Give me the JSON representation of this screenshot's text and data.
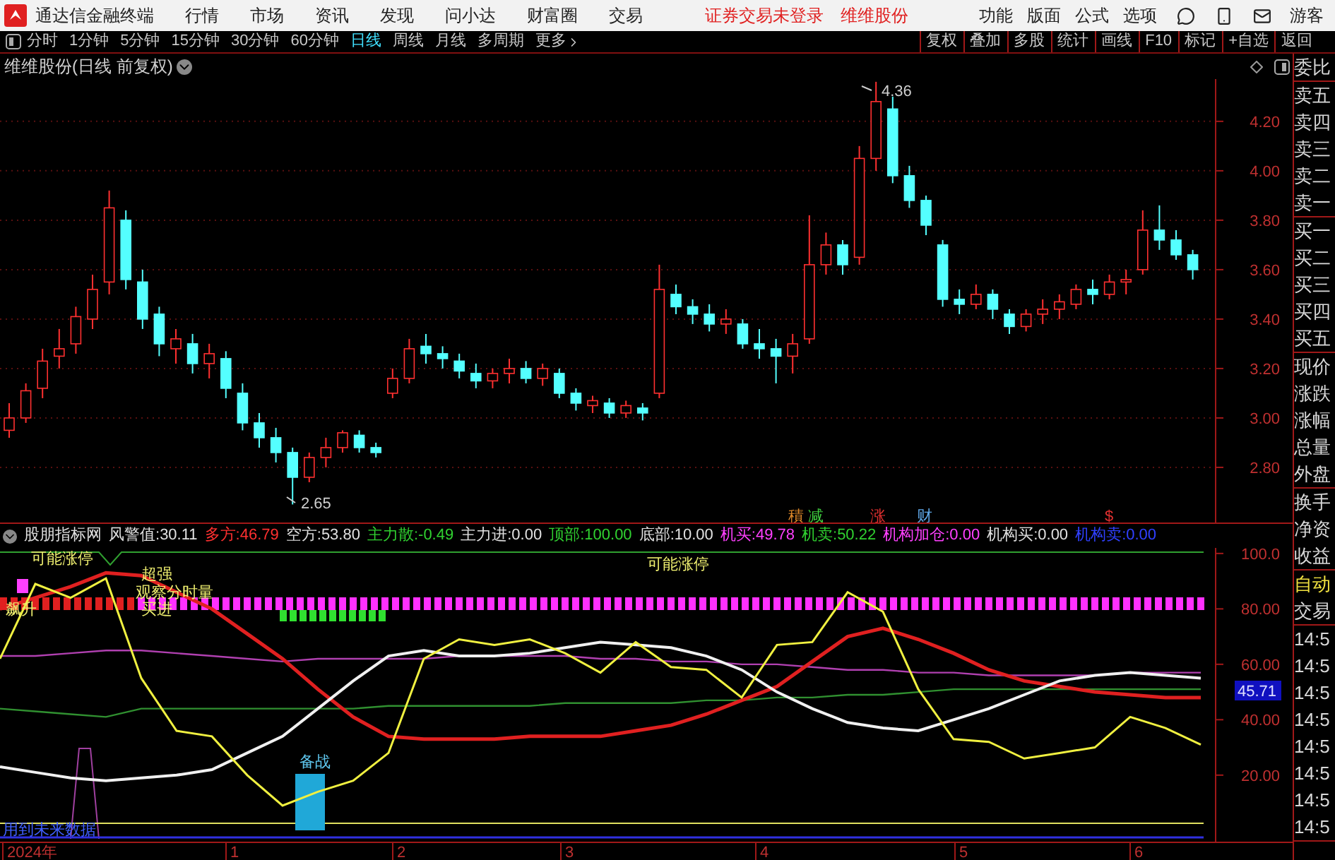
{
  "app_bar": {
    "title": "通达信金融终端",
    "menu": [
      "行情",
      "市场",
      "资讯",
      "发现",
      "问小达",
      "财富圈",
      "交易"
    ],
    "status": [
      "证券交易未登录",
      "维维股份"
    ],
    "right_menu": [
      "功能",
      "版面",
      "公式",
      "选项"
    ],
    "user": "游客"
  },
  "period_bar": {
    "tabs": [
      {
        "label": "分时",
        "selected": false
      },
      {
        "label": "1分钟",
        "selected": false
      },
      {
        "label": "5分钟",
        "selected": false
      },
      {
        "label": "15分钟",
        "selected": false
      },
      {
        "label": "30分钟",
        "selected": false
      },
      {
        "label": "60分钟",
        "selected": false
      },
      {
        "label": "日线",
        "selected": true
      },
      {
        "label": "周线",
        "selected": false
      },
      {
        "label": "月线",
        "selected": false
      },
      {
        "label": "多周期",
        "selected": false
      }
    ],
    "more": "更多",
    "buttons": [
      "复权",
      "叠加",
      "多股",
      "统计",
      "画线",
      "F10",
      "标记",
      "+自选",
      "返回"
    ]
  },
  "chart_title": "维维股份(日线 前复权)",
  "price_chart": {
    "high_label": "4.36",
    "low_label": "2.65",
    "event_marks": [
      {
        "text": "積",
        "color": "#e08a2a"
      },
      {
        "text": "减",
        "color": "#3fcf3f"
      },
      {
        "text": "涨",
        "color": "#e03030"
      },
      {
        "text": "财",
        "color": "#5fa8e8"
      },
      {
        "text": "$",
        "color": "#e03030"
      }
    ],
    "chart_data": {
      "type": "candlestick",
      "grid": true,
      "ylim": [
        2.577,
        4.371
      ],
      "yticks": [
        {
          "value": 4.2,
          "label": "4.20"
        },
        {
          "value": 4.0,
          "label": "4.00"
        },
        {
          "value": 3.8,
          "label": "3.80"
        },
        {
          "value": 3.6,
          "label": "3.60"
        },
        {
          "value": 3.4,
          "label": "3.40"
        },
        {
          "value": 3.2,
          "label": "3.20"
        },
        {
          "value": 3.0,
          "label": "3.00"
        },
        {
          "value": 2.8,
          "label": "2.80"
        }
      ],
      "ohlc": [
        [
          2.95,
          3.06,
          2.92,
          3.0
        ],
        [
          3.0,
          3.14,
          2.98,
          3.11
        ],
        [
          3.12,
          3.28,
          3.08,
          3.23
        ],
        [
          3.25,
          3.36,
          3.2,
          3.28
        ],
        [
          3.3,
          3.45,
          3.26,
          3.41
        ],
        [
          3.4,
          3.58,
          3.36,
          3.52
        ],
        [
          3.55,
          3.92,
          3.5,
          3.85
        ],
        [
          3.8,
          3.84,
          3.52,
          3.56
        ],
        [
          3.55,
          3.6,
          3.36,
          3.4
        ],
        [
          3.42,
          3.45,
          3.25,
          3.3
        ],
        [
          3.28,
          3.36,
          3.22,
          3.32
        ],
        [
          3.3,
          3.34,
          3.18,
          3.22
        ],
        [
          3.22,
          3.3,
          3.16,
          3.26
        ],
        [
          3.24,
          3.27,
          3.08,
          3.12
        ],
        [
          3.1,
          3.14,
          2.95,
          2.98
        ],
        [
          2.98,
          3.02,
          2.88,
          2.92
        ],
        [
          2.92,
          2.96,
          2.82,
          2.86
        ],
        [
          2.86,
          2.88,
          2.65,
          2.76
        ],
        [
          2.76,
          2.86,
          2.74,
          2.84
        ],
        [
          2.84,
          2.92,
          2.8,
          2.88
        ],
        [
          2.88,
          2.95,
          2.86,
          2.94
        ],
        [
          2.93,
          2.95,
          2.86,
          2.88
        ],
        [
          2.88,
          2.9,
          2.84,
          2.86
        ],
        [
          3.1,
          3.2,
          3.08,
          3.16
        ],
        [
          3.16,
          3.32,
          3.14,
          3.28
        ],
        [
          3.29,
          3.34,
          3.22,
          3.26
        ],
        [
          3.26,
          3.29,
          3.2,
          3.24
        ],
        [
          3.23,
          3.26,
          3.16,
          3.19
        ],
        [
          3.18,
          3.22,
          3.12,
          3.15
        ],
        [
          3.15,
          3.2,
          3.12,
          3.18
        ],
        [
          3.18,
          3.24,
          3.14,
          3.2
        ],
        [
          3.2,
          3.23,
          3.14,
          3.16
        ],
        [
          3.16,
          3.22,
          3.13,
          3.2
        ],
        [
          3.18,
          3.2,
          3.08,
          3.1
        ],
        [
          3.1,
          3.12,
          3.03,
          3.06
        ],
        [
          3.05,
          3.09,
          3.02,
          3.07
        ],
        [
          3.06,
          3.08,
          3.0,
          3.02
        ],
        [
          3.02,
          3.07,
          3.0,
          3.05
        ],
        [
          3.04,
          3.06,
          2.99,
          3.02
        ],
        [
          3.1,
          3.62,
          3.08,
          3.52
        ],
        [
          3.5,
          3.54,
          3.42,
          3.45
        ],
        [
          3.45,
          3.48,
          3.38,
          3.42
        ],
        [
          3.42,
          3.46,
          3.35,
          3.38
        ],
        [
          3.38,
          3.44,
          3.34,
          3.4
        ],
        [
          3.38,
          3.4,
          3.28,
          3.3
        ],
        [
          3.3,
          3.36,
          3.24,
          3.28
        ],
        [
          3.28,
          3.32,
          3.14,
          3.25
        ],
        [
          3.25,
          3.34,
          3.18,
          3.3
        ],
        [
          3.32,
          3.82,
          3.3,
          3.62
        ],
        [
          3.62,
          3.75,
          3.58,
          3.7
        ],
        [
          3.7,
          3.72,
          3.58,
          3.62
        ],
        [
          3.65,
          4.1,
          3.62,
          4.05
        ],
        [
          4.05,
          4.36,
          4.0,
          4.28
        ],
        [
          4.25,
          4.3,
          3.95,
          3.98
        ],
        [
          3.98,
          4.02,
          3.85,
          3.88
        ],
        [
          3.88,
          3.9,
          3.74,
          3.78
        ],
        [
          3.7,
          3.72,
          3.45,
          3.48
        ],
        [
          3.48,
          3.52,
          3.42,
          3.46
        ],
        [
          3.46,
          3.54,
          3.44,
          3.5
        ],
        [
          3.5,
          3.52,
          3.4,
          3.44
        ],
        [
          3.42,
          3.44,
          3.34,
          3.37
        ],
        [
          3.37,
          3.44,
          3.35,
          3.42
        ],
        [
          3.42,
          3.48,
          3.38,
          3.44
        ],
        [
          3.44,
          3.5,
          3.4,
          3.47
        ],
        [
          3.46,
          3.54,
          3.44,
          3.52
        ],
        [
          3.52,
          3.56,
          3.46,
          3.5
        ],
        [
          3.5,
          3.58,
          3.48,
          3.55
        ],
        [
          3.55,
          3.6,
          3.5,
          3.56
        ],
        [
          3.6,
          3.84,
          3.58,
          3.76
        ],
        [
          3.76,
          3.86,
          3.68,
          3.72
        ],
        [
          3.72,
          3.76,
          3.64,
          3.66
        ],
        [
          3.66,
          3.68,
          3.56,
          3.6
        ]
      ]
    }
  },
  "indicator": {
    "name": "股朋指标网",
    "readings": [
      {
        "label": "风警值:",
        "value": "30.11",
        "color": "#e0e0e0"
      },
      {
        "label": "多方:",
        "value": "46.79",
        "color": "#ff3030"
      },
      {
        "label": "空方:",
        "value": "53.80",
        "color": "#e0e0e0"
      },
      {
        "label": "主力散:",
        "value": "-0.49",
        "color": "#30d030"
      },
      {
        "label": "主力进:",
        "value": "0.00",
        "color": "#e0e0e0"
      },
      {
        "label": "顶部:",
        "value": "100.00",
        "color": "#30d030"
      },
      {
        "label": "底部:",
        "value": "10.00",
        "color": "#e0e0e0"
      },
      {
        "label": "机买:",
        "value": "49.78",
        "color": "#ff40ff"
      },
      {
        "label": "机卖:",
        "value": "50.22",
        "color": "#30d030"
      },
      {
        "label": "机构加仓:",
        "value": "0.00",
        "color": "#ff40ff"
      },
      {
        "label": "机构买:",
        "value": "0.00",
        "color": "#e0e0e0"
      },
      {
        "label": "机构卖:",
        "value": "0.00",
        "color": "#3040ff"
      }
    ],
    "date_axis": [
      "2024年",
      "1",
      "2",
      "3",
      "4",
      "5",
      "6"
    ],
    "chart_data": {
      "type": "line",
      "ylim": [
        -4,
        102
      ],
      "yticks": [
        {
          "value": 100,
          "label": "100.0"
        },
        {
          "value": 80,
          "label": "80.00"
        },
        {
          "value": 60,
          "label": "60.00"
        },
        {
          "value": 40,
          "label": "40.00"
        },
        {
          "value": 20,
          "label": "20.00"
        }
      ],
      "series": [
        {
          "color": "#b040b0",
          "values": [
            63,
            63,
            64,
            65,
            65,
            64,
            63,
            62,
            61,
            62,
            62,
            62,
            62,
            63,
            63,
            63,
            63,
            62,
            62,
            61,
            61,
            60,
            60,
            59,
            58,
            58,
            57,
            57,
            56,
            56,
            56,
            56,
            57,
            57,
            57
          ]
        },
        {
          "color": "#309030",
          "values": [
            44,
            43,
            42,
            41,
            44,
            44,
            44,
            44,
            44,
            44,
            44,
            45,
            45,
            45,
            45,
            45,
            46,
            46,
            46,
            46,
            47,
            47,
            48,
            48,
            49,
            49,
            50,
            51,
            51,
            51,
            51,
            51,
            51,
            51,
            51
          ]
        },
        {
          "color": "#e02020",
          "values": [
            80,
            84,
            88,
            93,
            92,
            86,
            80,
            71,
            62,
            51,
            41,
            34,
            33,
            33,
            33,
            34,
            34,
            34,
            36,
            38,
            42,
            47,
            52,
            61,
            70,
            73,
            69,
            64,
            58,
            54,
            52,
            50,
            49,
            48,
            48
          ]
        },
        {
          "color": "#f0f0f0",
          "values": [
            23,
            21,
            19,
            18,
            19,
            20,
            22,
            28,
            34,
            44,
            54,
            63,
            65,
            63,
            63,
            64,
            66,
            68,
            67,
            66,
            63,
            58,
            50,
            44,
            39,
            37,
            36,
            40,
            44,
            49,
            54,
            56,
            57,
            56,
            55
          ]
        },
        {
          "color": "#f0f040",
          "values": [
            62,
            89,
            84,
            91,
            55,
            36,
            34,
            20,
            9,
            14,
            18,
            28,
            62,
            69,
            67,
            69,
            64,
            57,
            68,
            59,
            58,
            48,
            67,
            68,
            86,
            79,
            51,
            33,
            32,
            26,
            28,
            30,
            41,
            37,
            31
          ]
        }
      ]
    },
    "current_value": "45.71",
    "annotations": [
      {
        "text": "可能涨停",
        "color": "#f0f070"
      },
      {
        "text": "可能涨停",
        "color": "#f0f070"
      },
      {
        "text": "超强",
        "color": "#f0f070"
      },
      {
        "text": "观察分时量",
        "color": "#f0f070"
      },
      {
        "text": "飙升",
        "color": "#f0f070"
      },
      {
        "text": "买进",
        "color": "#f0f070"
      },
      {
        "text": "备战",
        "color": "#5fc8f0"
      },
      {
        "text": "用到未来数据",
        "color": "#4060ff"
      }
    ]
  },
  "quote_panel": {
    "groups": [
      [
        {
          "label": "委比",
          "highlight": false
        }
      ],
      [
        {
          "label": "卖五",
          "highlight": false
        },
        {
          "label": "卖四",
          "highlight": false
        },
        {
          "label": "卖三",
          "highlight": false
        },
        {
          "label": "卖二",
          "highlight": false
        },
        {
          "label": "卖一",
          "highlight": false
        }
      ],
      [
        {
          "label": "买一",
          "highlight": false
        },
        {
          "label": "买二",
          "highlight": false
        },
        {
          "label": "买三",
          "highlight": false
        },
        {
          "label": "买四",
          "highlight": false
        },
        {
          "label": "买五",
          "highlight": false
        }
      ],
      [
        {
          "label": "现价",
          "highlight": false
        },
        {
          "label": "涨跌",
          "highlight": false
        },
        {
          "label": "涨幅",
          "highlight": false
        },
        {
          "label": "总量",
          "highlight": false
        },
        {
          "label": "外盘",
          "highlight": false
        }
      ],
      [
        {
          "label": "换手",
          "highlight": false
        },
        {
          "label": "净资",
          "highlight": false
        },
        {
          "label": "收益",
          "highlight": false
        }
      ],
      [
        {
          "label": "自动",
          "highlight": true
        },
        {
          "label": "交易",
          "highlight": false
        }
      ],
      [
        {
          "label": "14:5",
          "highlight": false
        },
        {
          "label": "14:5",
          "highlight": false
        },
        {
          "label": "14:5",
          "highlight": false
        },
        {
          "label": "14:5",
          "highlight": false
        },
        {
          "label": "14:5",
          "highlight": false
        },
        {
          "label": "14:5",
          "highlight": false
        },
        {
          "label": "14:5",
          "highlight": false
        },
        {
          "label": "14:5",
          "highlight": false
        }
      ]
    ]
  }
}
